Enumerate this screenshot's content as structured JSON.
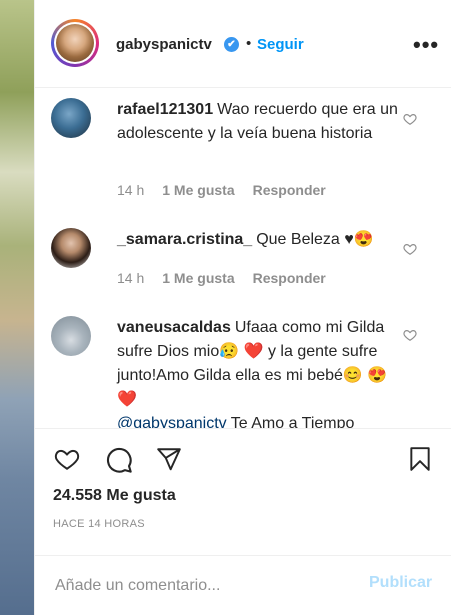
{
  "post": {
    "username": "gabyspanictv",
    "verified_mark": "✔",
    "separator": "•",
    "follow_label": "Seguir",
    "more_label": "•••"
  },
  "comments": [
    {
      "username": "rafael121301",
      "text": "Wao recuerdo que era un adolescente y la veía buena historia",
      "mention": "",
      "time": "14 h",
      "likes": "1 Me gusta",
      "reply": "Responder"
    },
    {
      "username": "_samara.cristina_",
      "text": "Que Beleza ♥😍",
      "mention": "",
      "time": "14 h",
      "likes": "1 Me gusta",
      "reply": "Responder"
    },
    {
      "username": "vaneusacaldas",
      "text": "Ufaaa como mi Gilda sufre Dios mio😥 ❤️ y la gente sufre junto!Amo Gilda ella es mi bebé😊 😍 ❤️",
      "mention": "@gabyspanictv",
      "after_mention": " Te Amo a Tiempo",
      "time": "",
      "likes": "",
      "reply": ""
    }
  ],
  "actions": {
    "like_icon": "heart-outline-icon",
    "comment_icon": "comment-bubble-icon",
    "share_icon": "paper-plane-icon",
    "save_icon": "bookmark-icon",
    "likes_count": "24.558 Me gusta",
    "timestamp": "HACE 14 HORAS"
  },
  "composer": {
    "placeholder": "Añade un comentario...",
    "publish_label": "Publicar"
  }
}
